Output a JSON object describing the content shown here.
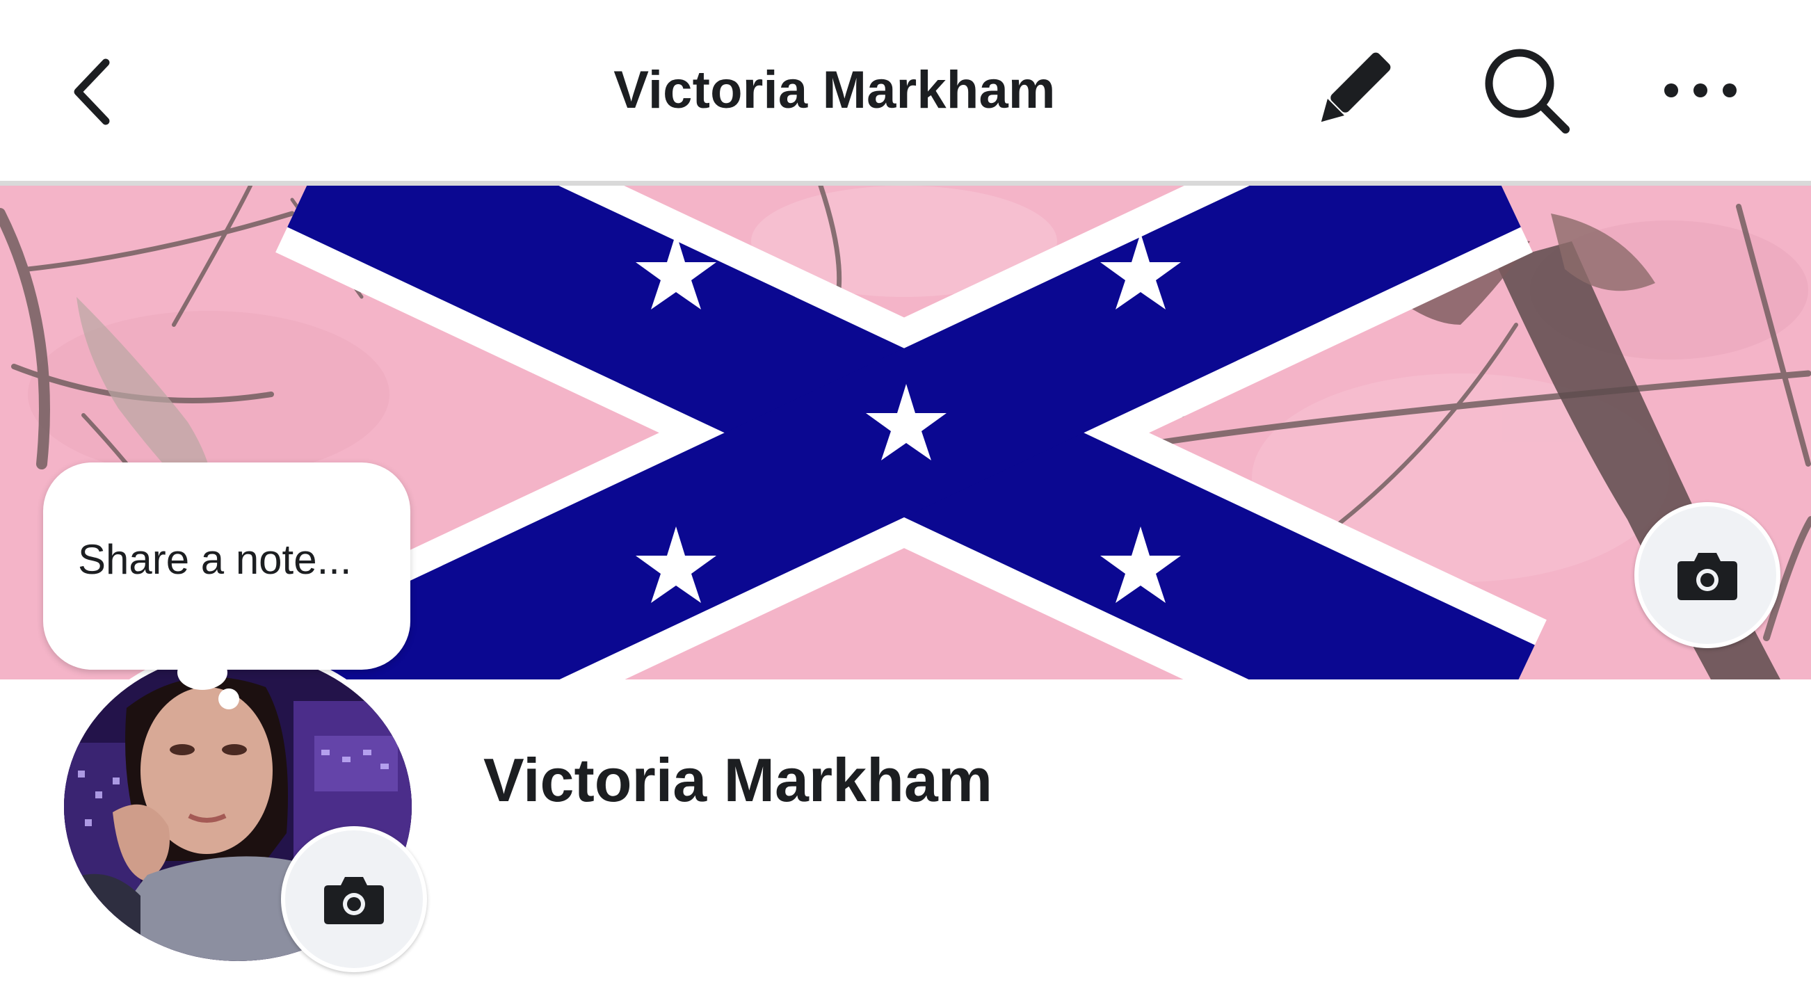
{
  "header": {
    "title": "Victoria Markham",
    "back_icon": "chevron-left-icon",
    "edit_icon": "pencil-icon",
    "search_icon": "search-icon",
    "more_icon": "more-horizontal-icon"
  },
  "cover": {
    "camera_icon": "camera-icon",
    "colors": {
      "background": "#f3b2c7",
      "cross_blue": "#0b0891",
      "cross_border": "#ffffff"
    }
  },
  "note": {
    "placeholder": "Share a note..."
  },
  "profile": {
    "name": "Victoria Markham",
    "camera_icon": "camera-icon"
  },
  "colors": {
    "text": "#1c1e21",
    "button_bg": "#f0f2f5",
    "divider": "#d9d9d9"
  }
}
